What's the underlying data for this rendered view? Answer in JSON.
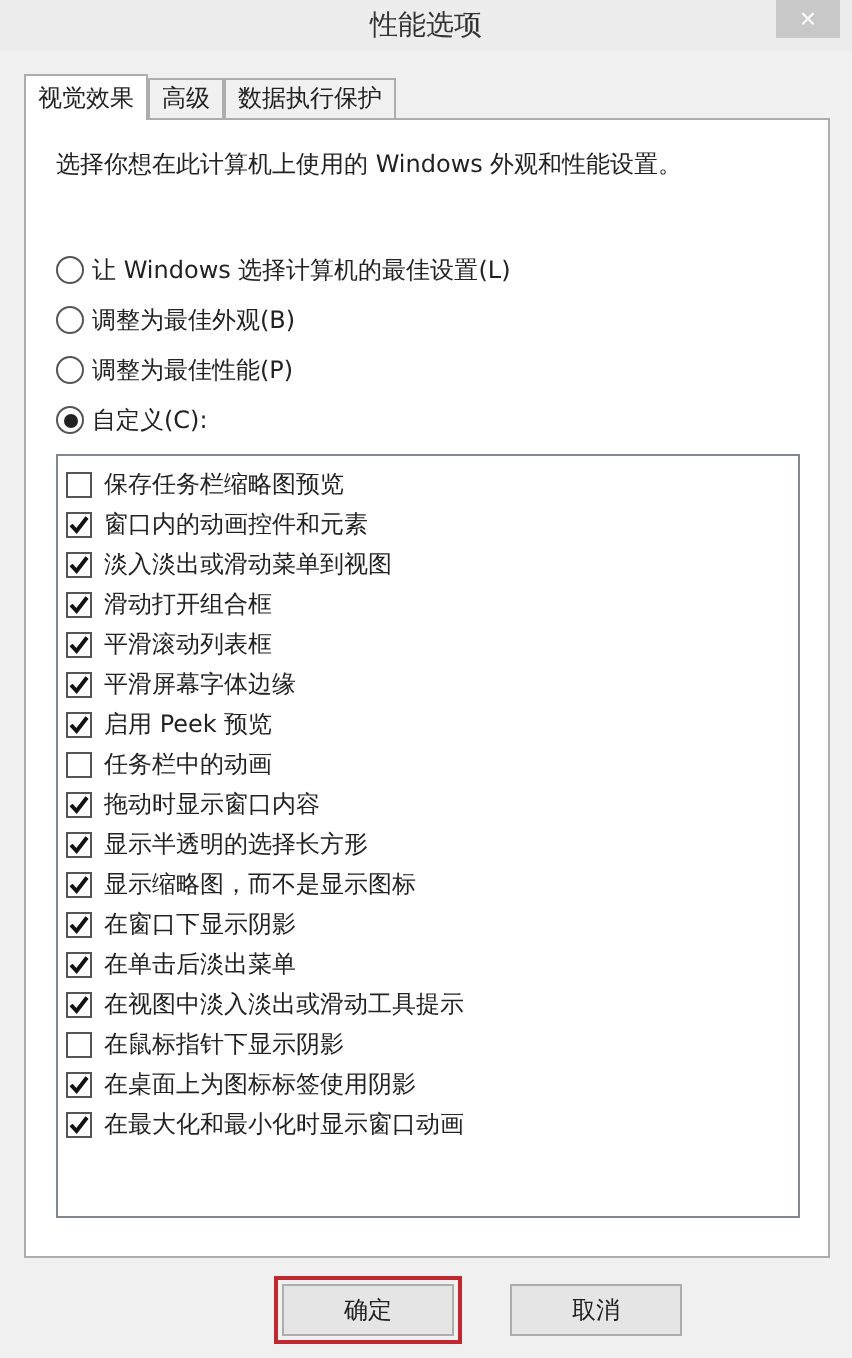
{
  "window": {
    "title": "性能选项",
    "close": "×"
  },
  "tabs": [
    {
      "label": "视觉效果",
      "selected": true
    },
    {
      "label": "高级",
      "selected": false
    },
    {
      "label": "数据执行保护",
      "selected": false
    }
  ],
  "description": "选择你想在此计算机上使用的 Windows 外观和性能设置。",
  "radios": [
    {
      "label": "让 Windows 选择计算机的最佳设置(L)",
      "selected": false
    },
    {
      "label": "调整为最佳外观(B)",
      "selected": false
    },
    {
      "label": "调整为最佳性能(P)",
      "selected": false
    },
    {
      "label": "自定义(C):",
      "selected": true
    }
  ],
  "options": [
    {
      "label": "保存任务栏缩略图预览",
      "checked": false
    },
    {
      "label": "窗口内的动画控件和元素",
      "checked": true
    },
    {
      "label": "淡入淡出或滑动菜单到视图",
      "checked": true
    },
    {
      "label": "滑动打开组合框",
      "checked": true
    },
    {
      "label": "平滑滚动列表框",
      "checked": true
    },
    {
      "label": "平滑屏幕字体边缘",
      "checked": true
    },
    {
      "label": "启用 Peek 预览",
      "checked": true
    },
    {
      "label": "任务栏中的动画",
      "checked": false
    },
    {
      "label": "拖动时显示窗口内容",
      "checked": true
    },
    {
      "label": "显示半透明的选择长方形",
      "checked": true
    },
    {
      "label": "显示缩略图，而不是显示图标",
      "checked": true
    },
    {
      "label": "在窗口下显示阴影",
      "checked": true
    },
    {
      "label": "在单击后淡出菜单",
      "checked": true
    },
    {
      "label": "在视图中淡入淡出或滑动工具提示",
      "checked": true
    },
    {
      "label": "在鼠标指针下显示阴影",
      "checked": false
    },
    {
      "label": "在桌面上为图标标签使用阴影",
      "checked": true
    },
    {
      "label": "在最大化和最小化时显示窗口动画",
      "checked": true
    }
  ],
  "buttons": [
    {
      "label": "确定",
      "highlighted": true
    },
    {
      "label": "取消",
      "highlighted": false
    }
  ]
}
